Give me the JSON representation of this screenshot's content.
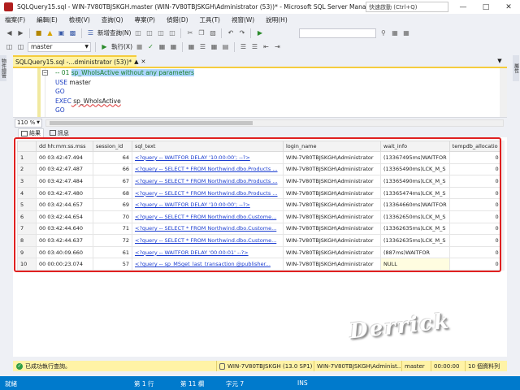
{
  "window": {
    "title": "SQLQuery15.sql - WIN-7V80TBJSKGH.master (WIN-7V80TBJSKGH\\Administrator (53))* - Microsoft SQL Server Manage...",
    "quick_launch_placeholder": "快速啟動 (Ctrl+Q)"
  },
  "menu": [
    "檔案(F)",
    "編輯(E)",
    "檢視(V)",
    "查詢(Q)",
    "專案(P)",
    "偵錯(D)",
    "工具(T)",
    "視窗(W)",
    "說明(H)"
  ],
  "toolbar": {
    "new_query_label": "新增查詢(N)",
    "database_value": "master",
    "execute_label": "執行(X)"
  },
  "side_panels": {
    "left_tab": "物件總管",
    "right_tab": "屬性"
  },
  "editor": {
    "tab_title": "SQLQuery15.sql -...dministrator (53))*",
    "lines": [
      {
        "prefix": "-- 01 ",
        "selected": "sp_WhoIsActive without any parameters",
        "rest": ""
      },
      {
        "kw": "USE",
        "text": " master"
      },
      {
        "kw": "GO",
        "text": ""
      },
      {
        "kw": "EXEC",
        "text": " sp_WhoIsActive"
      },
      {
        "kw": "GO",
        "text": ""
      }
    ],
    "zoom": "110 %"
  },
  "results": {
    "tabs": [
      "結果",
      "訊息"
    ],
    "columns": [
      "",
      "dd hh:mm:ss.mss",
      "session_id",
      "sql_text",
      "login_name",
      "wait_info",
      "tempdb_allocatio"
    ],
    "rows": [
      [
        "1",
        "00 03:42:47.494",
        "64",
        "<?query --  WAITFOR DELAY '10:00:00';  --?>",
        "WIN-7V80TBJSKGH\\Administrator",
        "(13367495ms)WAITFOR",
        "0"
      ],
      [
        "2",
        "00 03:42:47.487",
        "66",
        "<?query --  SELECT * FROM Northwind.dbo.Products ...",
        "WIN-7V80TBJSKGH\\Administrator",
        "(13365490ms)LCK_M_S",
        "0"
      ],
      [
        "3",
        "00 03:42:47.484",
        "67",
        "<?query --  SELECT * FROM Northwind.dbo.Products ...",
        "WIN-7V80TBJSKGH\\Administrator",
        "(13365490ms)LCK_M_S",
        "0"
      ],
      [
        "4",
        "00 03:42:47.480",
        "68",
        "<?query --  SELECT * FROM Northwind.dbo.Products ...",
        "WIN-7V80TBJSKGH\\Administrator",
        "(13365474ms)LCK_M_S",
        "0"
      ],
      [
        "5",
        "00 03:42:44.657",
        "69",
        "<?query --  WAITFOR DELAY '10:00:00';  --?>",
        "WIN-7V80TBJSKGH\\Administrator",
        "(13364660ms)WAITFOR",
        "0"
      ],
      [
        "6",
        "00 03:42:44.654",
        "70",
        "<?query --  SELECT * FROM Northwind.dbo.Custome...",
        "WIN-7V80TBJSKGH\\Administrator",
        "(13362650ms)LCK_M_S",
        "0"
      ],
      [
        "7",
        "00 03:42:44.640",
        "71",
        "<?query --  SELECT * FROM Northwind.dbo.Custome...",
        "WIN-7V80TBJSKGH\\Administrator",
        "(13362635ms)LCK_M_S",
        "0"
      ],
      [
        "8",
        "00 03:42:44.637",
        "72",
        "<?query --  SELECT * FROM Northwind.dbo.Custome...",
        "WIN-7V80TBJSKGH\\Administrator",
        "(13362635ms)LCK_M_S",
        "0"
      ],
      [
        "9",
        "00 03:40:09.660",
        "61",
        "<?query --  WAITFOR DELAY '00:00:01'  --?>",
        "WIN-7V80TBJSKGH\\Administrator",
        "(887ms)WAITFOR",
        "0"
      ],
      [
        "10",
        "00 00:00:23.074",
        "57",
        "<?query --  sp_MSget_last_transaction @publisher...",
        "WIN-7V80TBJSKGH\\Administrator",
        "NULL",
        "0"
      ]
    ]
  },
  "watermark": "Derrick",
  "query_status": {
    "message": "已成功執行查詢。",
    "server": "WIN-7V80TBJSKGH (13.0 SP1)",
    "login": "WIN-7V80TBJSKGH\\Administ...",
    "database": "master",
    "elapsed": "00:00:00",
    "rows": "10 個資料列"
  },
  "status_bar": {
    "ready": "就緒",
    "line": "第 1 行",
    "col": "第 11 欄",
    "char": "字元 7",
    "ins": "INS"
  }
}
